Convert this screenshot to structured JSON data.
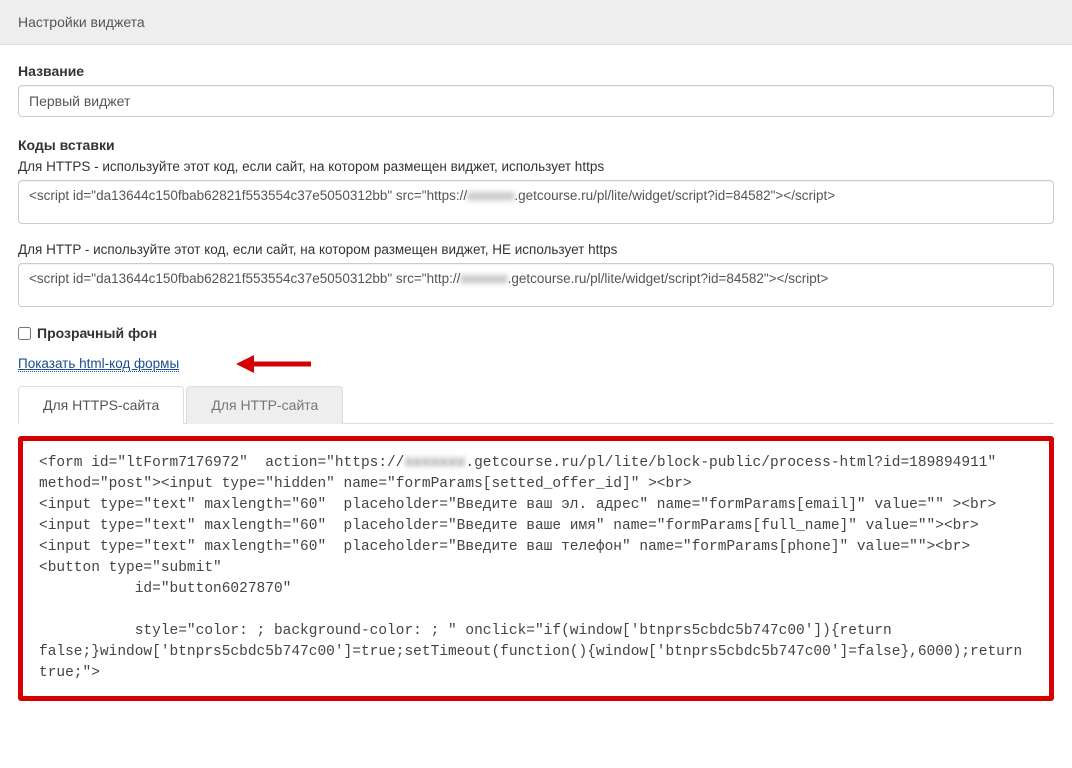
{
  "header": {
    "title": "Настройки виджета"
  },
  "name_section": {
    "label": "Название",
    "value": "Первый виджет"
  },
  "embed_section": {
    "label": "Коды вставки",
    "https_label": "Для HTTPS - используйте этот код, если сайт, на котором размещен виджет, использует https",
    "https_code_pre": "<script id=\"da13644c150fbab62821f553554c37e5050312bb\" src=\"https://",
    "https_code_blur": "xxxxxxx",
    "https_code_post": ".getcourse.ru/pl/lite/widget/script?id=84582\"></script>",
    "http_label": "Для HTTP - используйте этот код, если сайт, на котором размещен виджет, НЕ использует https",
    "http_code_pre": "<script id=\"da13644c150fbab62821f553554c37e5050312bb\" src=\"http://",
    "http_code_blur": "xxxxxxx",
    "http_code_post": ".getcourse.ru/pl/lite/widget/script?id=84582\"></script>"
  },
  "transparent": {
    "label": "Прозрачный фон",
    "checked": false
  },
  "show_form_link": "Показать html-код формы",
  "tabs": {
    "https": "Для HTTPS-сайта",
    "http": "Для HTTP-сайта"
  },
  "form_code": {
    "line1_pre": "<form id=\"ltForm7176972\"  action=\"https://",
    "line1_blur": "xxxxxxx",
    "line1_post": ".getcourse.ru/pl/lite/block-public/process-html?id=189894911\" method=\"post\"><input type=\"hidden\" name=\"formParams[setted_offer_id]\" ><br>",
    "line2": "<input type=\"text\" maxlength=\"60\"  placeholder=\"Введите ваш эл. адрес\" name=\"formParams[email]\" value=\"\" ><br>",
    "line3": "<input type=\"text\" maxlength=\"60\"  placeholder=\"Введите ваше имя\" name=\"formParams[full_name]\" value=\"\"><br>",
    "line4": "<input type=\"text\" maxlength=\"60\"  placeholder=\"Введите ваш телефон\" name=\"formParams[phone]\" value=\"\"><br>",
    "line5": "<button type=\"submit\"",
    "line6": "           id=\"button6027870\"",
    "line7": "",
    "line8": "           style=\"color: ; background-color: ; \" onclick=\"if(window['btnprs5cbdc5b747c00']){return false;}window['btnprs5cbdc5b747c00']=true;setTimeout(function(){window['btnprs5cbdc5b747c00']=false},6000);return true;\">"
  }
}
